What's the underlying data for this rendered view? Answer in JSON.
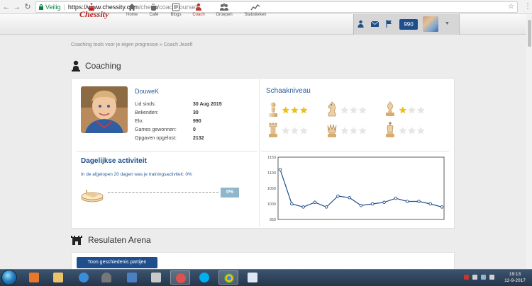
{
  "browser": {
    "secure_label": "Veilig",
    "url_host": "https://www.chessity.com",
    "url_path": "/chess/coachyourself",
    "nav": [
      "←",
      "→",
      "↻"
    ]
  },
  "site": {
    "logo": "Chessity",
    "nav": [
      {
        "label": "Home",
        "icon": "home-icon"
      },
      {
        "label": "Café",
        "icon": "cafe-icon"
      },
      {
        "label": "Blogs",
        "icon": "blogs-icon"
      },
      {
        "label": "Coach",
        "icon": "coach-icon",
        "active": true
      },
      {
        "label": "Groepen",
        "icon": "groups-icon"
      },
      {
        "label": "Statistieken",
        "icon": "stats-icon"
      }
    ],
    "elo_badge": "990",
    "accent": "#1f4e8c",
    "active_nav_color": "#c0392b"
  },
  "breadcrumb": "Coaching tools voor je eigen progressie » Coach Jezelf",
  "coaching": {
    "title": "Coaching",
    "username": "DouweK",
    "stats": [
      {
        "label": "Lid sinds:",
        "value": "30 Aug 2015"
      },
      {
        "label": "Bekenden:",
        "value": "30"
      },
      {
        "label": "Elo:",
        "value": "990"
      },
      {
        "label": "Games gewonnen:",
        "value": "0"
      },
      {
        "label": "Opgaven opgelost:",
        "value": "2132"
      }
    ],
    "level_title": "Schaakniveau",
    "levels": [
      {
        "piece": "pawn",
        "color": "white",
        "stars": 3
      },
      {
        "piece": "knight",
        "color": "white",
        "stars": 0
      },
      {
        "piece": "bishop",
        "color": "white",
        "stars": 1
      },
      {
        "piece": "rook",
        "color": "white",
        "stars": 0
      },
      {
        "piece": "queen",
        "color": "white",
        "stars": 0
      },
      {
        "piece": "king",
        "color": "white",
        "stars": 0
      }
    ],
    "activity_title": "Dagelijkse activiteit",
    "activity_text": "In de afgelopen 20 dagen was je trainingsactiviteit: 0%",
    "activity_pct": "0%",
    "activity_value": 0
  },
  "chart_data": {
    "type": "line",
    "values": [
      1110,
      1000,
      990,
      1005,
      990,
      1025,
      1020,
      995,
      1000,
      1005,
      1018,
      1008,
      1008,
      1000,
      990
    ],
    "ylim": [
      950,
      1150
    ],
    "yticks": [
      "1150",
      "1100",
      "1050",
      "1000",
      "950"
    ],
    "color": "#1f4e8c"
  },
  "arena": {
    "title": "Resulaten Arena",
    "button": "Toon geschiedenis partijen"
  },
  "taskbar": {
    "time": "19:13",
    "date": "12-9-2017"
  }
}
